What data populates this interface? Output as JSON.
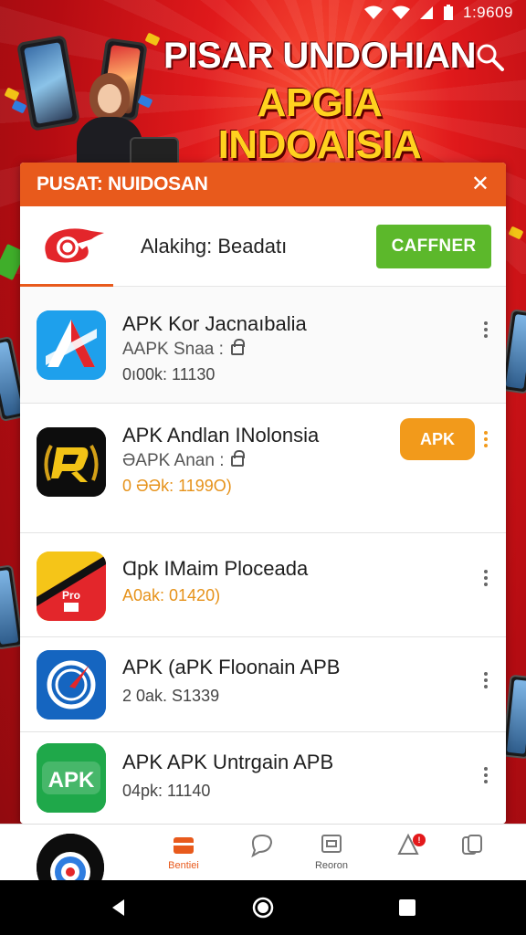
{
  "status_bar": {
    "time": "1:9609"
  },
  "hero": {
    "title_line1": "PISAR UNDOHIAN",
    "title_line2": "APGIA INDOAISIA"
  },
  "card": {
    "title": "PUSAT: NUIDOSAN",
    "featured": {
      "name": "Alakihg: Beadatı",
      "button_label": "CAFFNER"
    },
    "apps": [
      {
        "title": "APK Kor Jacnaıbalia",
        "subtitle": "AAPK  Snaa :",
        "meta": "0ı00k: 11130"
      },
      {
        "title": "APK Andlan INolonsia",
        "subtitle": "ƏAPK  Anan :",
        "meta": "0 ƏƏk: 1199O)",
        "badge": "APK"
      },
      {
        "title": "Ɑpk IMaim Ploceada",
        "meta": "A0ak: 01420)"
      },
      {
        "title": "APK (aPK Floonain APB",
        "meta": "2 0ak. S1339"
      },
      {
        "title": "APK  APK Untrgain APB",
        "meta": "04pk: 11140",
        "icon_text": "APK"
      }
    ]
  },
  "bottom_nav": {
    "items": [
      {
        "label": "Bentiei",
        "icon": "store-icon"
      },
      {
        "label": "",
        "icon": "chat-icon"
      },
      {
        "label": "Reoron",
        "icon": "window-icon"
      },
      {
        "label": "",
        "icon": "bell-icon",
        "badge": "!"
      },
      {
        "label": "",
        "icon": "tabs-icon"
      }
    ]
  },
  "colors": {
    "brand_orange": "#e85a1c",
    "green_button": "#5cb82b",
    "badge_orange": "#f29a1b",
    "background_red": "#c8141a"
  }
}
